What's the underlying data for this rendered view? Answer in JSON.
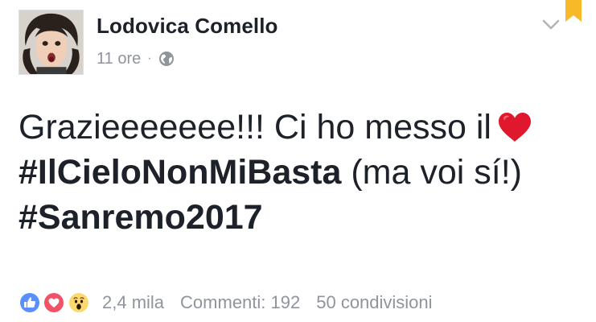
{
  "post": {
    "author": "Lodovica Comello",
    "time": "11 ore",
    "separator": "·",
    "privacy_icon": "globe-icon",
    "menu_icon": "chevron-down-icon",
    "save_icon": "bookmark-icon",
    "text": {
      "line1": "Grazieeeeeee!!! Ci ho messo il",
      "line1_emoji": "heart-emoji",
      "hashtag1": "#IlCieloNonMiBasta",
      "line2_rest": " (ma voi sí!)",
      "hashtag2": "#Sanremo2017"
    }
  },
  "footer": {
    "reactions": [
      "like-icon",
      "love-icon",
      "wow-icon"
    ],
    "reaction_count": "2,4 mila",
    "comments": "Commenti: 192",
    "shares": "50 condivisioni"
  },
  "colors": {
    "text": "#1d2129",
    "meta": "#90949c",
    "like": "#5890ff",
    "love": "#f25268",
    "wow": "#fcd86e",
    "bookmark": "#f7b928",
    "heart": "#e0182d"
  }
}
